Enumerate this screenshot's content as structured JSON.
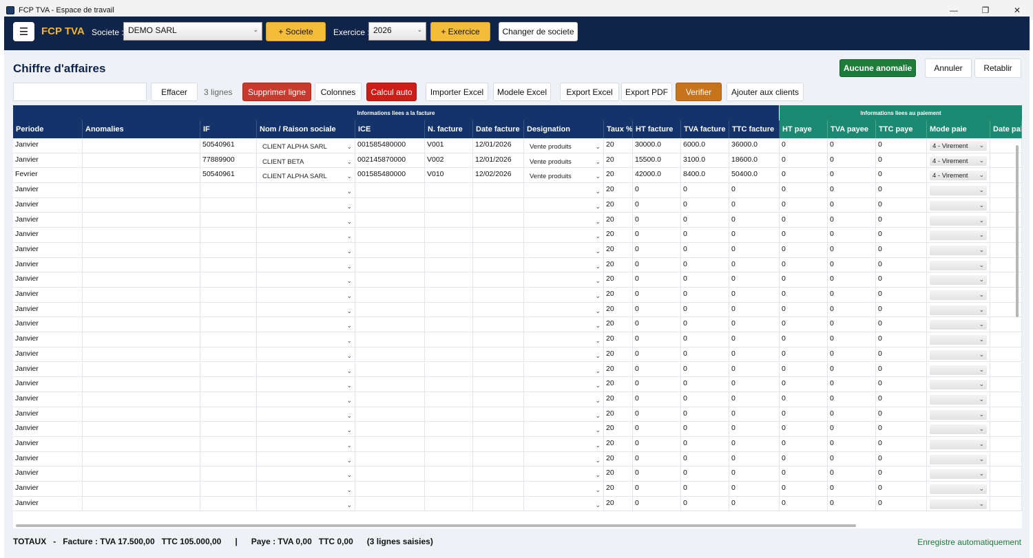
{
  "window": {
    "title": "FCP TVA - Espace de travail",
    "minimize": "—",
    "maximize": "❐",
    "close": "✕"
  },
  "header": {
    "menu_icon": "☰",
    "brand": "FCP TVA",
    "societe_label": "Societe :",
    "societe_value": "DEMO SARL",
    "add_societe": "+ Societe",
    "exercice_label": "Exercice :",
    "exercice_value": "2026",
    "add_exercice": "+ Exercice",
    "changer": "Changer de societe"
  },
  "page": {
    "title": "Chiffre d'affaires"
  },
  "actions": {
    "aucune_anomalie": "Aucune anomalie",
    "annuler": "Annuler",
    "retablir": "Retablir"
  },
  "toolbar": {
    "search_value": "",
    "effacer": "Effacer",
    "count": "3 lignes",
    "supprimer": "Supprimer ligne",
    "colonnes": "Colonnes",
    "calcul": "Calcul auto",
    "importer": "Importer Excel",
    "modele": "Modele Excel",
    "export_excel": "Export Excel",
    "export_pdf": "Export PDF",
    "verifier": "Verifier",
    "ajouter": "Ajouter aux clients"
  },
  "grid": {
    "groups": {
      "facture": "Informations liees a la facture",
      "paiement": "Informations liees au paiement"
    },
    "columns": [
      "Periode",
      "Anomalies",
      "IF",
      "Nom / Raison sociale",
      "ICE",
      "N. facture",
      "Date facture",
      "Designation",
      "Taux %",
      "HT facture",
      "TVA facture",
      "TTC facture",
      "HT paye",
      "TVA payee",
      "TTC paye",
      "Mode paie",
      "Date paie"
    ],
    "filled_rows": [
      [
        "Janvier",
        "",
        "50540961",
        "CLIENT ALPHA SARL",
        "001585480000",
        "V001",
        "12/01/2026",
        "Vente produits",
        "20",
        "30000.0",
        "6000.0",
        "36000.0",
        "0",
        "0",
        "0",
        "4 - Virement",
        ""
      ],
      [
        "Janvier",
        "",
        "77889900",
        "CLIENT BETA",
        "002145870000",
        "V002",
        "12/01/2026",
        "Vente produits",
        "20",
        "15500.0",
        "3100.0",
        "18600.0",
        "0",
        "0",
        "0",
        "4 - Virement",
        ""
      ],
      [
        "Fevrier",
        "",
        "50540961",
        "CLIENT ALPHA SARL",
        "001585480000",
        "V010",
        "12/02/2026",
        "Vente produits",
        "20",
        "42000.0",
        "8400.0",
        "50400.0",
        "0",
        "0",
        "0",
        "4 - Virement",
        ""
      ]
    ],
    "empty_row": [
      "Janvier",
      "",
      "",
      "",
      "",
      "",
      "",
      "",
      "20",
      "0",
      "0",
      "0",
      "0",
      "0",
      "0",
      "",
      ""
    ],
    "empty_row_count": 22
  },
  "footer": {
    "totals": "TOTAUX   -   Facture : TVA 17.500,00   TTC 105.000,00      |      Paye : TVA 0,00   TTC 0,00      (3 lignes saisies)",
    "autosave": "Enregistre automatiquement"
  },
  "colors": {
    "navy": "#0f2448",
    "header_blue": "#14336a",
    "teal": "#1c8a72",
    "accent_yellow": "#f4bd39",
    "brand": "#f4b630",
    "green": "#1d7c3a"
  }
}
